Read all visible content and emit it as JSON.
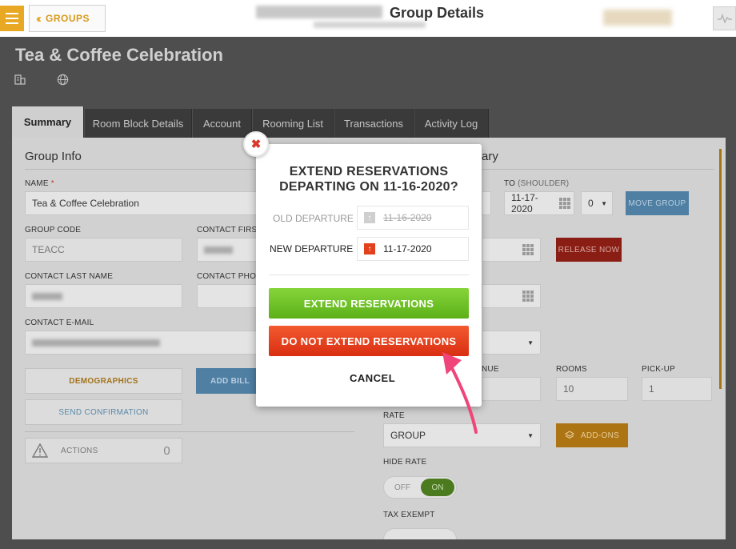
{
  "topbar": {
    "groups_label": "GROUPS",
    "page_title": "Group Details"
  },
  "header": {
    "group_name": "Tea & Coffee Celebration"
  },
  "tabs": [
    "Summary",
    "Room Block Details",
    "Account",
    "Rooming List",
    "Transactions",
    "Activity Log"
  ],
  "group_info": {
    "title": "Group Info",
    "name_label": "NAME",
    "name_required": "*",
    "name_value": "Tea & Coffee Celebration",
    "group_code_label": "GROUP CODE",
    "group_code_value": "TEACC",
    "contact_first_label": "CONTACT FIRST",
    "contact_last_label": "CONTACT LAST NAME",
    "contact_phone_label": "CONTACT PHON",
    "contact_email_label": "CONTACT E-MAIL",
    "demographics_label": "DEMOGRAPHICS",
    "add_bill_label": "ADD BILL",
    "send_confirmation_label": "SEND CONFIRMATION",
    "actions_label": "ACTIONS",
    "actions_count": "0"
  },
  "summary": {
    "title_fragment": "ary",
    "to_label": "TO",
    "shoulder_label": "(SHOULDER)",
    "to_value": "11-17-2020",
    "shoulder_value": "0",
    "move_group_label": "MOVE GROUP",
    "release_now_label": "RELEASE NOW",
    "revenue_label_fragment": "NUE",
    "rooms_label": "ROOMS",
    "rooms_value": "10",
    "pickup_label": "PICK-UP",
    "pickup_value": "1",
    "rate_label": "RATE",
    "rate_value": "GROUP",
    "addons_label": "ADD-ONS",
    "hide_rate_label": "HIDE RATE",
    "toggle_off": "OFF",
    "toggle_on": "ON",
    "tax_exempt_label": "TAX EXEMPT"
  },
  "modal": {
    "title_line1": "EXTEND RESERVATIONS",
    "title_line2": "DEPARTING ON 11-16-2020?",
    "old_departure_label": "OLD DEPARTURE",
    "old_departure_value": "11-16-2020",
    "new_departure_label": "NEW DEPARTURE",
    "new_departure_value": "11-17-2020",
    "extend_label": "EXTEND RESERVATIONS",
    "do_not_extend_label": "DO NOT EXTEND RESERVATIONS",
    "cancel_label": "CANCEL"
  },
  "colors": {
    "accent": "#e8a824",
    "green": "#6cc224",
    "red": "#e3401d",
    "pointer": "#f0457a"
  }
}
